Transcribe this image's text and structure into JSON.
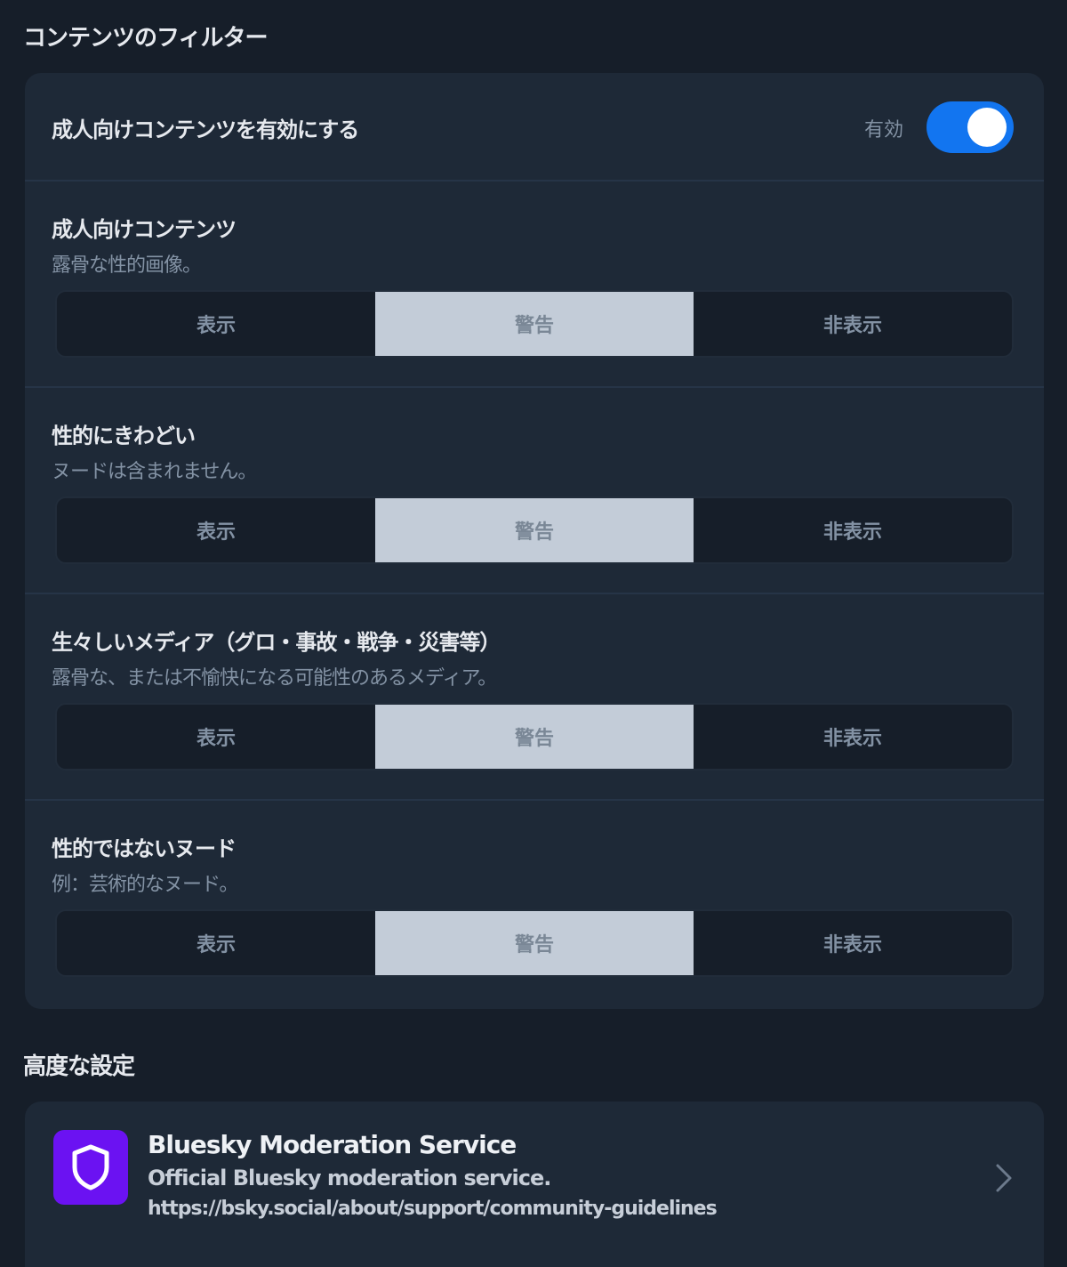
{
  "content_filters": {
    "title": "コンテンツのフィルター",
    "adult_toggle": {
      "label": "成人向けコンテンツを有効にする",
      "state_label": "有効",
      "enabled": true
    },
    "options": [
      "表示",
      "警告",
      "非表示"
    ],
    "filters": [
      {
        "title": "成人向けコンテンツ",
        "description": "露骨な性的画像。",
        "selected": "警告"
      },
      {
        "title": "性的にきわどい",
        "description": "ヌードは含まれません。",
        "selected": "警告"
      },
      {
        "title": "生々しいメディア（グロ・事故・戦争・災害等）",
        "description": "露骨な、または不愉快になる可能性のあるメディア。",
        "selected": "警告"
      },
      {
        "title": "性的ではないヌード",
        "description": "例：芸術的なヌード。",
        "selected": "警告"
      }
    ]
  },
  "advanced": {
    "title": "高度な設定",
    "service": {
      "name": "Bluesky Moderation Service",
      "description": "Official Bluesky moderation service.",
      "link": "https://bsky.social/about/support/community-guidelines",
      "icon": "shield-icon",
      "avatar_color": "#6b12f2"
    }
  },
  "colors": {
    "accent": "#1275f0",
    "background": "#161e29",
    "card": "#1e2937",
    "selected_segment": "#c3ccd8"
  }
}
